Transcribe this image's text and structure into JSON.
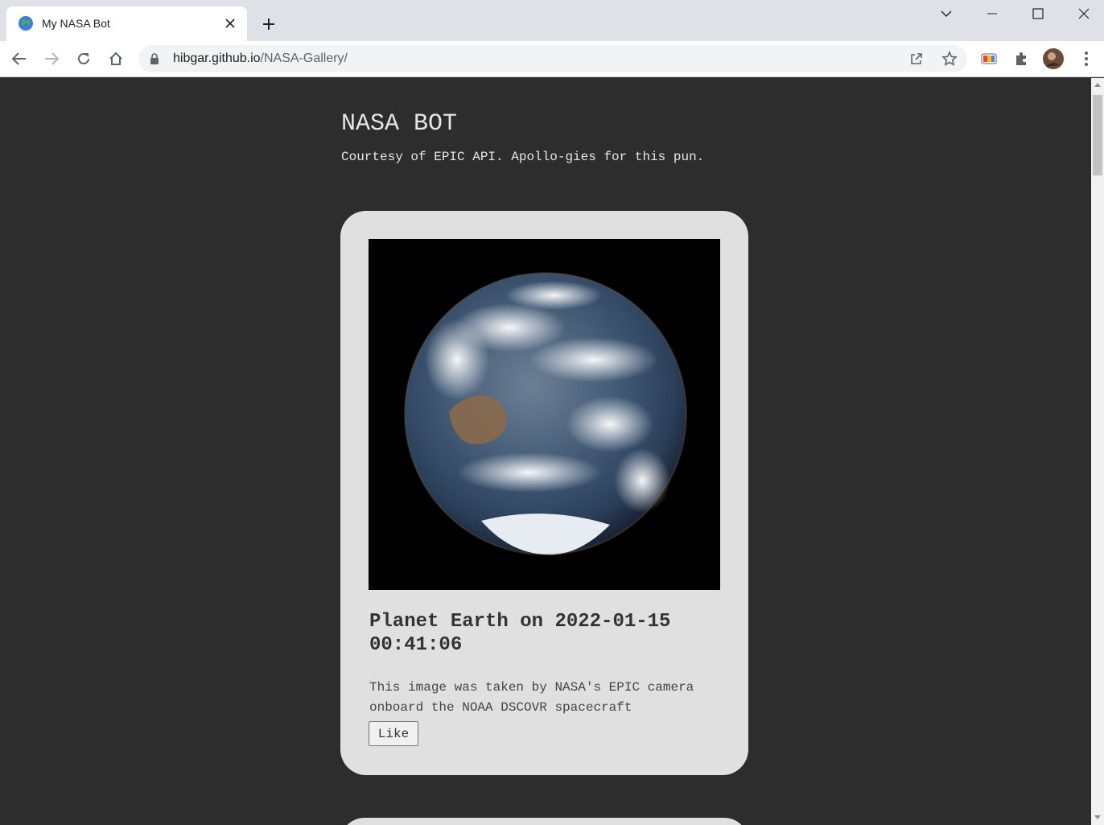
{
  "browser": {
    "tab_title": "My NASA Bot",
    "url_host": "hibgar.github.io",
    "url_path": "/NASA-Gallery/"
  },
  "page": {
    "title": "NASA BOT",
    "subtitle": "Courtesy of EPIC API. Apollo-gies for this pun."
  },
  "cards": [
    {
      "image_alt": "Earth photo from DSCOVR EPIC",
      "title": "Planet Earth on 2022-01-15 00:41:06",
      "description": "This image was taken by NASA's EPIC camera onboard the NOAA DSCOVR spacecraft",
      "like_label": "Like"
    }
  ],
  "colors": {
    "page_background": "#2d2d2d",
    "card_background": "#e0e0e0",
    "heading_text": "#e6e6e6"
  }
}
